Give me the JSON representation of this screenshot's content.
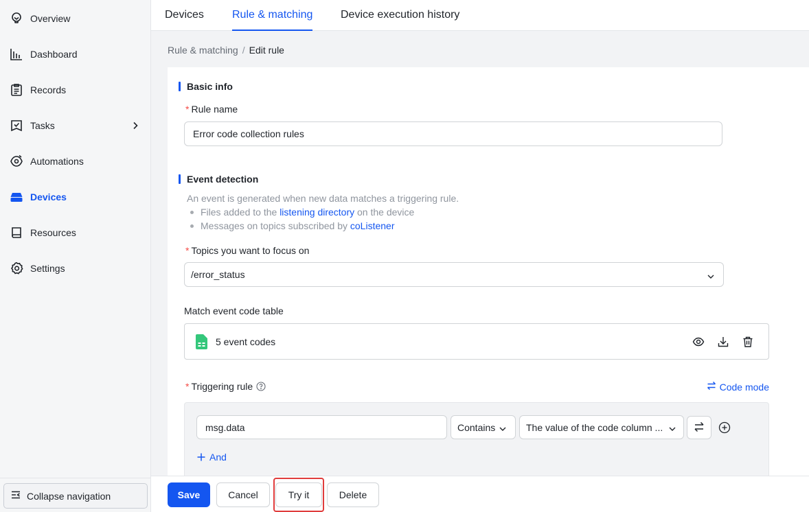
{
  "sidebar": {
    "items": [
      {
        "label": "Overview",
        "icon": "lightbulb-icon"
      },
      {
        "label": "Dashboard",
        "icon": "bar-chart-icon"
      },
      {
        "label": "Records",
        "icon": "clipboard-icon"
      },
      {
        "label": "Tasks",
        "icon": "task-icon"
      },
      {
        "label": "Automations",
        "icon": "automation-icon"
      },
      {
        "label": "Devices",
        "icon": "device-icon",
        "active": true
      },
      {
        "label": "Resources",
        "icon": "book-icon"
      },
      {
        "label": "Settings",
        "icon": "gear-icon"
      }
    ],
    "collapse_label": "Collapse navigation"
  },
  "tabs": [
    {
      "label": "Devices"
    },
    {
      "label": "Rule & matching",
      "active": true
    },
    {
      "label": "Device execution history"
    }
  ],
  "breadcrumb": {
    "parent": "Rule & matching",
    "separator": "/",
    "current": "Edit rule"
  },
  "basic_info": {
    "title": "Basic info",
    "required_mark": "*",
    "rule_name_label": "Rule name",
    "rule_name_value": "Error code collection rules"
  },
  "event_detection": {
    "title": "Event detection",
    "description": "An event is generated when new data matches a triggering rule.",
    "bullet1_prefix": "Files added to the ",
    "bullet1_link": "listening directory",
    "bullet1_suffix": " on the device",
    "bullet2_prefix": "Messages on topics subscribed by ",
    "bullet2_link": "coListener",
    "topics_label": "Topics you want to focus on",
    "topics_value": "/error_status",
    "table_label": "Match event code table",
    "table_name": "5 event codes",
    "trigger_label": "Triggering rule",
    "code_mode_label": "Code mode",
    "condition_field": "msg.data",
    "condition_operator": "Contains",
    "condition_value": "The value of the code column ...",
    "and_label": "And"
  },
  "footer": {
    "save": "Save",
    "cancel": "Cancel",
    "try_it": "Try it",
    "delete": "Delete"
  },
  "colors": {
    "accent": "#1456f0",
    "required": "#f54a45",
    "highlight": "#e03c3c",
    "sheet_icon": "#34c77b"
  }
}
